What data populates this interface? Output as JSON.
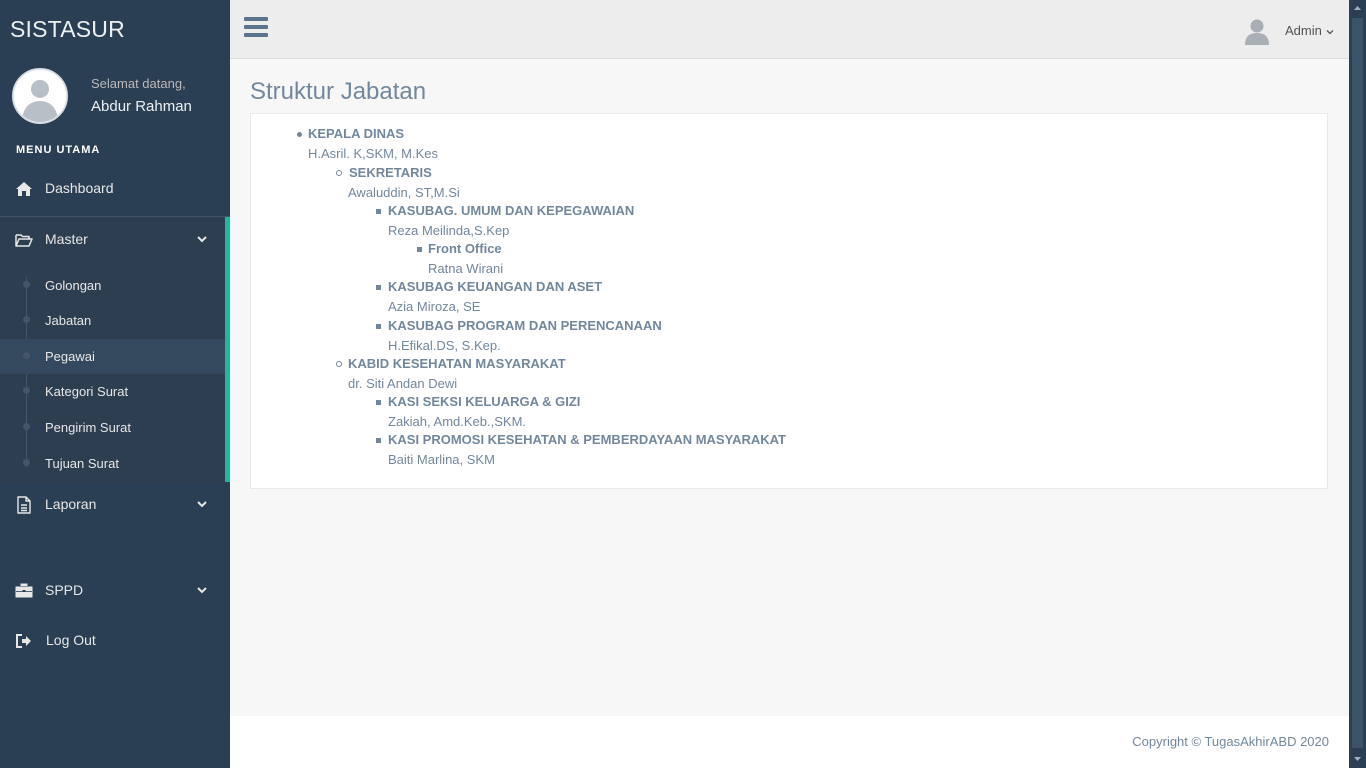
{
  "app": {
    "brand": "SISTASUR"
  },
  "profile": {
    "welcome": "Selamat datang,",
    "name": "Abdur Rahman"
  },
  "sidebar": {
    "menu_title": "MENU UTAMA",
    "dashboard": "Dashboard",
    "master": "Master",
    "master_items": [
      "Golongan",
      "Jabatan",
      "Pegawai",
      "Kategori Surat",
      "Pengirim Surat",
      "Tujuan Surat"
    ],
    "active_item": "Pegawai",
    "laporan": "Laporan",
    "sppd": "SPPD",
    "logout": "Log Out"
  },
  "topbar": {
    "user": "Admin"
  },
  "page": {
    "title": "Struktur Jabatan"
  },
  "structure": [
    {
      "position": "KEPALA DINAS",
      "holder": "H.Asril. K,SKM, M.Kes",
      "level": 0
    },
    {
      "position": "SEKRETARIS",
      "holder": "Awaluddin, ST,M.Si",
      "level": 1
    },
    {
      "position": "KASUBAG. UMUM DAN KEPEGAWAIAN",
      "holder": "Reza Meilinda,S.Kep",
      "level": 2
    },
    {
      "position": "Front Office",
      "holder": "Ratna Wirani",
      "level": 3
    },
    {
      "position": "KASUBAG KEUANGAN DAN ASET",
      "holder": "Azia Miroza, SE",
      "level": 2
    },
    {
      "position": "KASUBAG PROGRAM DAN PERENCANAAN",
      "holder": "H.Efikal.DS, S.Kep.",
      "level": 2
    },
    {
      "position": "KABID KESEHATAN MASYARAKAT",
      "holder": "dr. Siti Andan Dewi",
      "level": 1
    },
    {
      "position": "KASI SEKSI KELUARGA & GIZI",
      "holder": "Zakiah, Amd.Keb.,SKM.",
      "level": 2
    },
    {
      "position": "KASI PROMOSI KESEHATAN & PEMBERDAYAAN MASYARAKAT",
      "holder": "Baiti Marlina, SKM",
      "level": 2
    }
  ],
  "footer": {
    "copyright": "Copyright © TugasAkhirABD 2020"
  },
  "colors": {
    "sidebar": "#2A3F54",
    "accent": "#1ABB9C",
    "text": "#73879C"
  }
}
